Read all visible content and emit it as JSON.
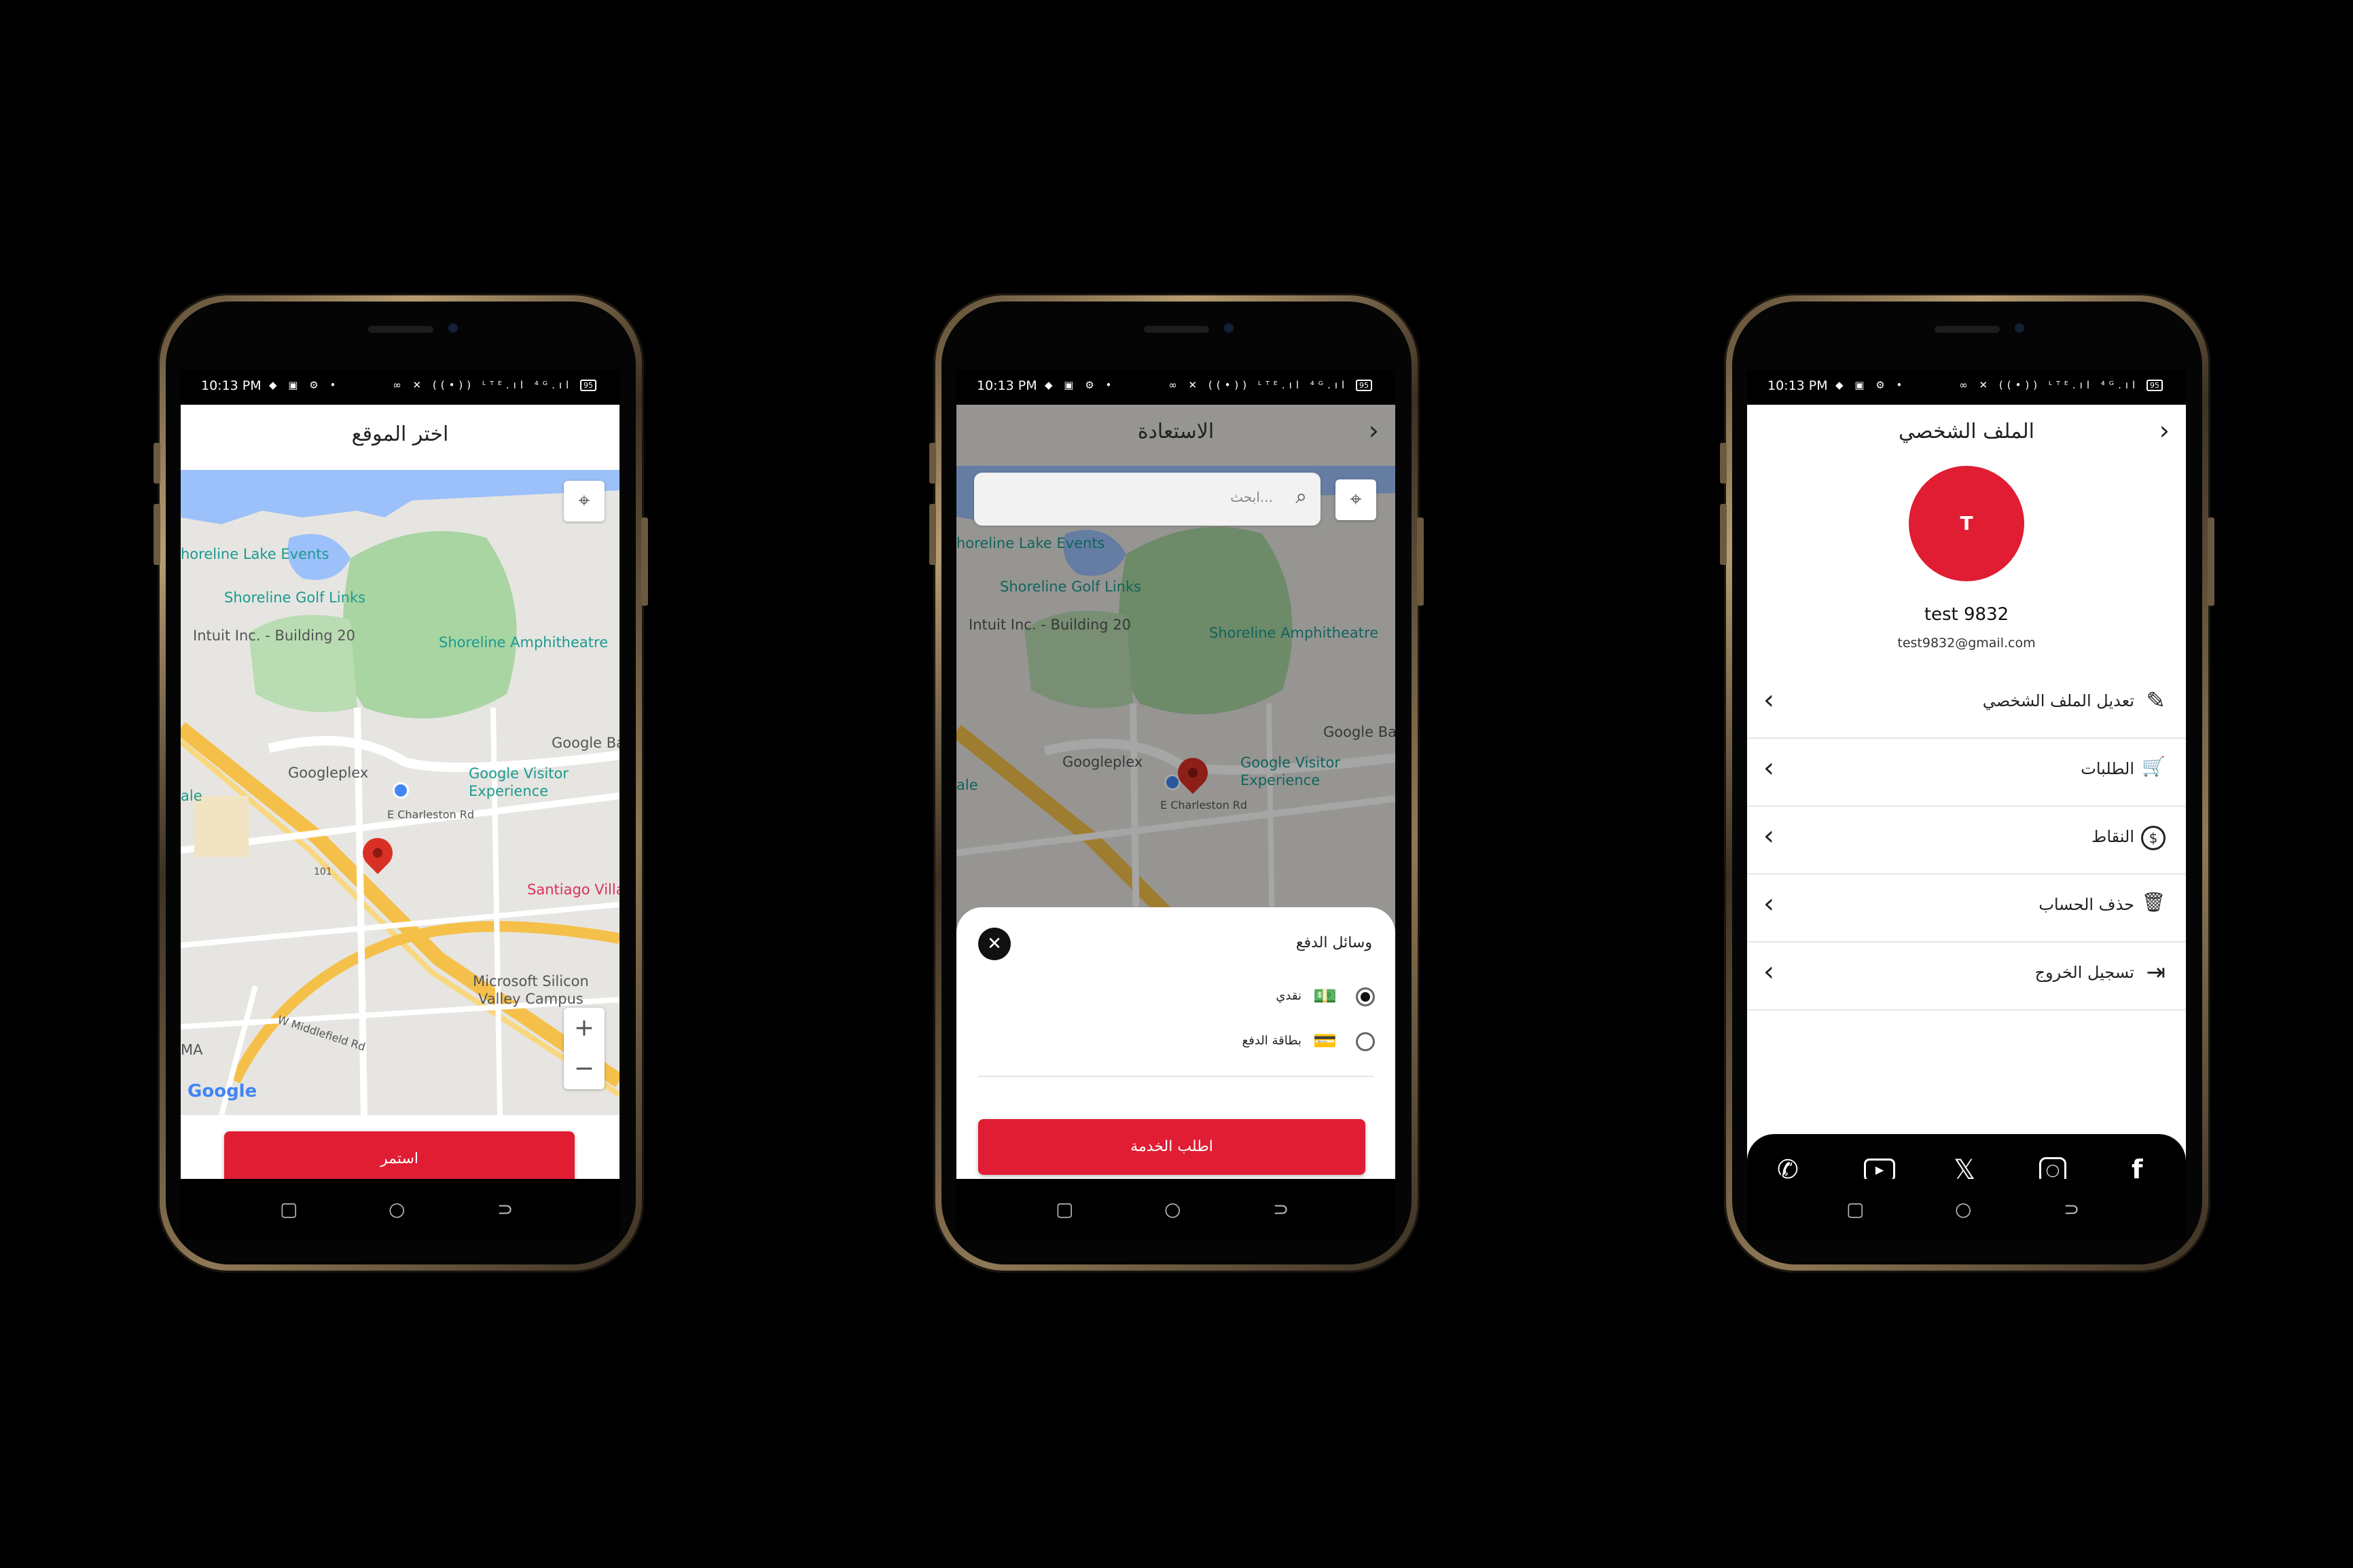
{
  "status_bar": {
    "time": "10:13 PM",
    "icons": "◆ ▣ ⚙ •",
    "right_icons": "∞ ✕ ((•)) ᴸᵀᴱ.ıl ⁴ᴳ.ıl",
    "battery": "95"
  },
  "nav": {
    "square": "▢",
    "circle": "○",
    "back": "⊃"
  },
  "screen1": {
    "title": "اختر الموقع",
    "continue_label": "استمر",
    "map_labels": {
      "lake_events": "horeline Lake Events",
      "golf_links": "Shoreline Golf Links",
      "intuit": "Intuit Inc. - Building 20",
      "amphitheatre": "Shoreline Amphitheatre",
      "google_ba": "Google Ba",
      "googleplex": "Googleplex",
      "visitor": "Google Visitor\nExperience",
      "charleston": "E Charleston Rd",
      "hwy": "101",
      "santiago": "Santiago Villa",
      "microsoft": "Microsoft Silicon\nValley Campus",
      "middlefield": "W Middlefield Rd",
      "ma": "MA",
      "ale": "ale",
      "google_logo": "Google"
    }
  },
  "screen2": {
    "title": "الاستعادة",
    "search_placeholder": "ابحث...",
    "sheet_title": "وسائل الدفع",
    "cash_label": "نقدي",
    "card_label": "بطاقة الدفع",
    "request_label": "اطلب الخدمة",
    "map_labels": {
      "lake_events": "horeline Lake Events",
      "golf_links": "Shoreline Golf Links",
      "intuit": "Intuit Inc. - Building 20",
      "amphitheatre": "Shoreline Amphitheatre",
      "google_ba": "Google Ba",
      "googleplex": "Googleplex",
      "visitor": "Google Visitor\nExperience",
      "charleston": "E Charleston Rd",
      "ale": "ale"
    }
  },
  "screen3": {
    "title": "الملف الشخصي",
    "avatar_letter": "T",
    "user_name": "test 9832",
    "user_email": "test9832@gmail.com",
    "menu": [
      {
        "label": "تعديل الملف الشخصي",
        "icon": "pencil-icon",
        "glyph": "✎"
      },
      {
        "label": "الطلبات",
        "icon": "cart-icon",
        "glyph": "🛒"
      },
      {
        "label": "النقاط",
        "icon": "dollar-circle-icon",
        "glyph": "$"
      },
      {
        "label": "حذف الحساب",
        "icon": "trash-icon",
        "glyph": "🗑"
      },
      {
        "label": "تسجيل الخروج",
        "icon": "logout-icon",
        "glyph": "⇥"
      }
    ],
    "social": [
      "whatsapp-icon",
      "youtube-icon",
      "x-icon",
      "instagram-icon",
      "facebook-icon"
    ]
  },
  "colors": {
    "accent": "#e01d32",
    "map_water": "#9cc0f9",
    "map_park": "#a8d5a2",
    "highway": "#f5c04a"
  }
}
